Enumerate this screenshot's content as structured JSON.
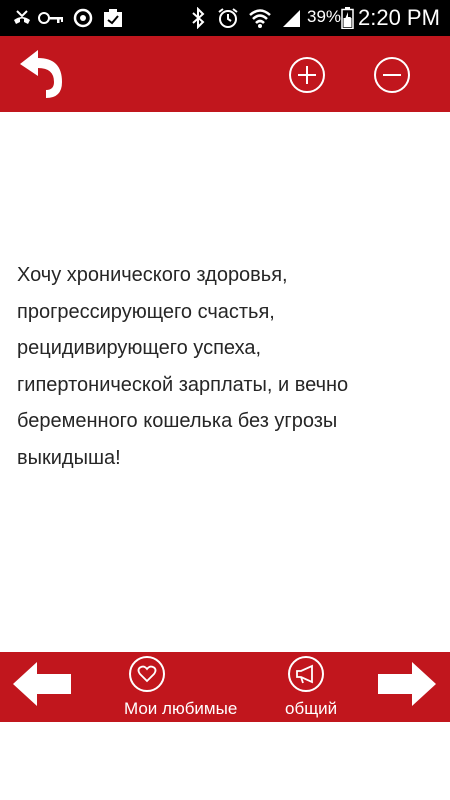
{
  "status_bar": {
    "icons": [
      "missed-call-icon",
      "key-icon",
      "sync-icon",
      "clipboard-icon",
      "bluetooth-icon",
      "alarm-icon",
      "wifi-icon",
      "signal-icon",
      "battery-icon"
    ],
    "battery_percent": "39%",
    "time": "2:20 PM"
  },
  "toolbar": {
    "back_icon": "back-arrow-icon",
    "zoom_in_icon": "plus-circle-icon",
    "zoom_out_icon": "minus-circle-icon"
  },
  "content": {
    "lines": [
      "Хочу хронического здоровья,",
      "прогрессирующего счастья,",
      "рецидивирующего успеха,",
      "гипертонической зарплаты, и вечно",
      "беременного кошелька без угрозы",
      "выкидыша!"
    ]
  },
  "bottom_bar": {
    "favorites_label": "Мои любимые",
    "share_label": "общий",
    "prev_icon": "arrow-left-icon",
    "next_icon": "arrow-right-icon"
  },
  "colors": {
    "accent": "#c1161d",
    "status_bar": "#000000",
    "text": "#262626"
  }
}
